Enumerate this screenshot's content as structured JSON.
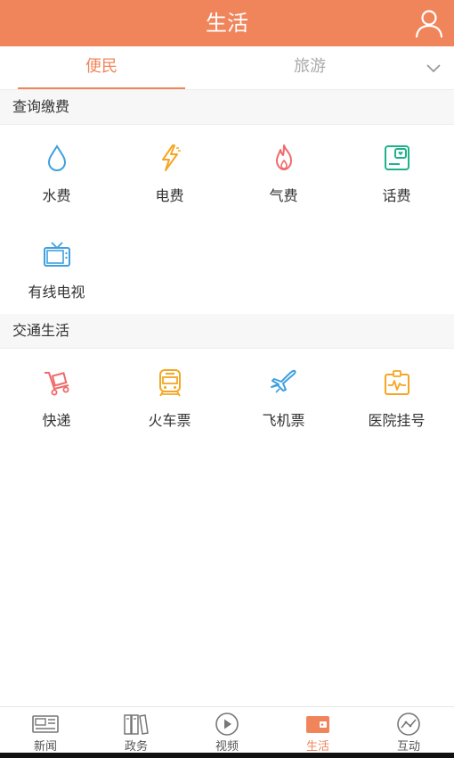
{
  "header": {
    "title": "生活"
  },
  "tabs": [
    {
      "label": "便民",
      "active": true
    },
    {
      "label": "旅游",
      "active": false
    }
  ],
  "sections": [
    {
      "title": "查询缴费",
      "items": [
        {
          "label": "水费",
          "icon": "water-drop-icon",
          "color": "#3fa0e0"
        },
        {
          "label": "电费",
          "icon": "lightning-icon",
          "color": "#f5a623"
        },
        {
          "label": "气费",
          "icon": "flame-icon",
          "color": "#f06a6a"
        },
        {
          "label": "话费",
          "icon": "phone-bill-icon",
          "color": "#1db38a"
        },
        {
          "label": "有线电视",
          "icon": "tv-icon",
          "color": "#3fa0e0"
        }
      ]
    },
    {
      "title": "交通生活",
      "items": [
        {
          "label": "快递",
          "icon": "delivery-cart-icon",
          "color": "#f06a6a"
        },
        {
          "label": "火车票",
          "icon": "train-icon",
          "color": "#f5a623"
        },
        {
          "label": "飞机票",
          "icon": "airplane-icon",
          "color": "#3fa0e0"
        },
        {
          "label": "医院挂号",
          "icon": "hospital-monitor-icon",
          "color": "#f5a623"
        }
      ]
    }
  ],
  "bottom_nav": [
    {
      "label": "新闻",
      "icon": "newspaper-icon",
      "active": false
    },
    {
      "label": "政务",
      "icon": "binders-icon",
      "active": false
    },
    {
      "label": "视频",
      "icon": "play-circle-icon",
      "active": false
    },
    {
      "label": "生活",
      "icon": "wallet-icon",
      "active": true
    },
    {
      "label": "互动",
      "icon": "chart-circle-icon",
      "active": false
    }
  ],
  "colors": {
    "accent": "#f0855b"
  }
}
